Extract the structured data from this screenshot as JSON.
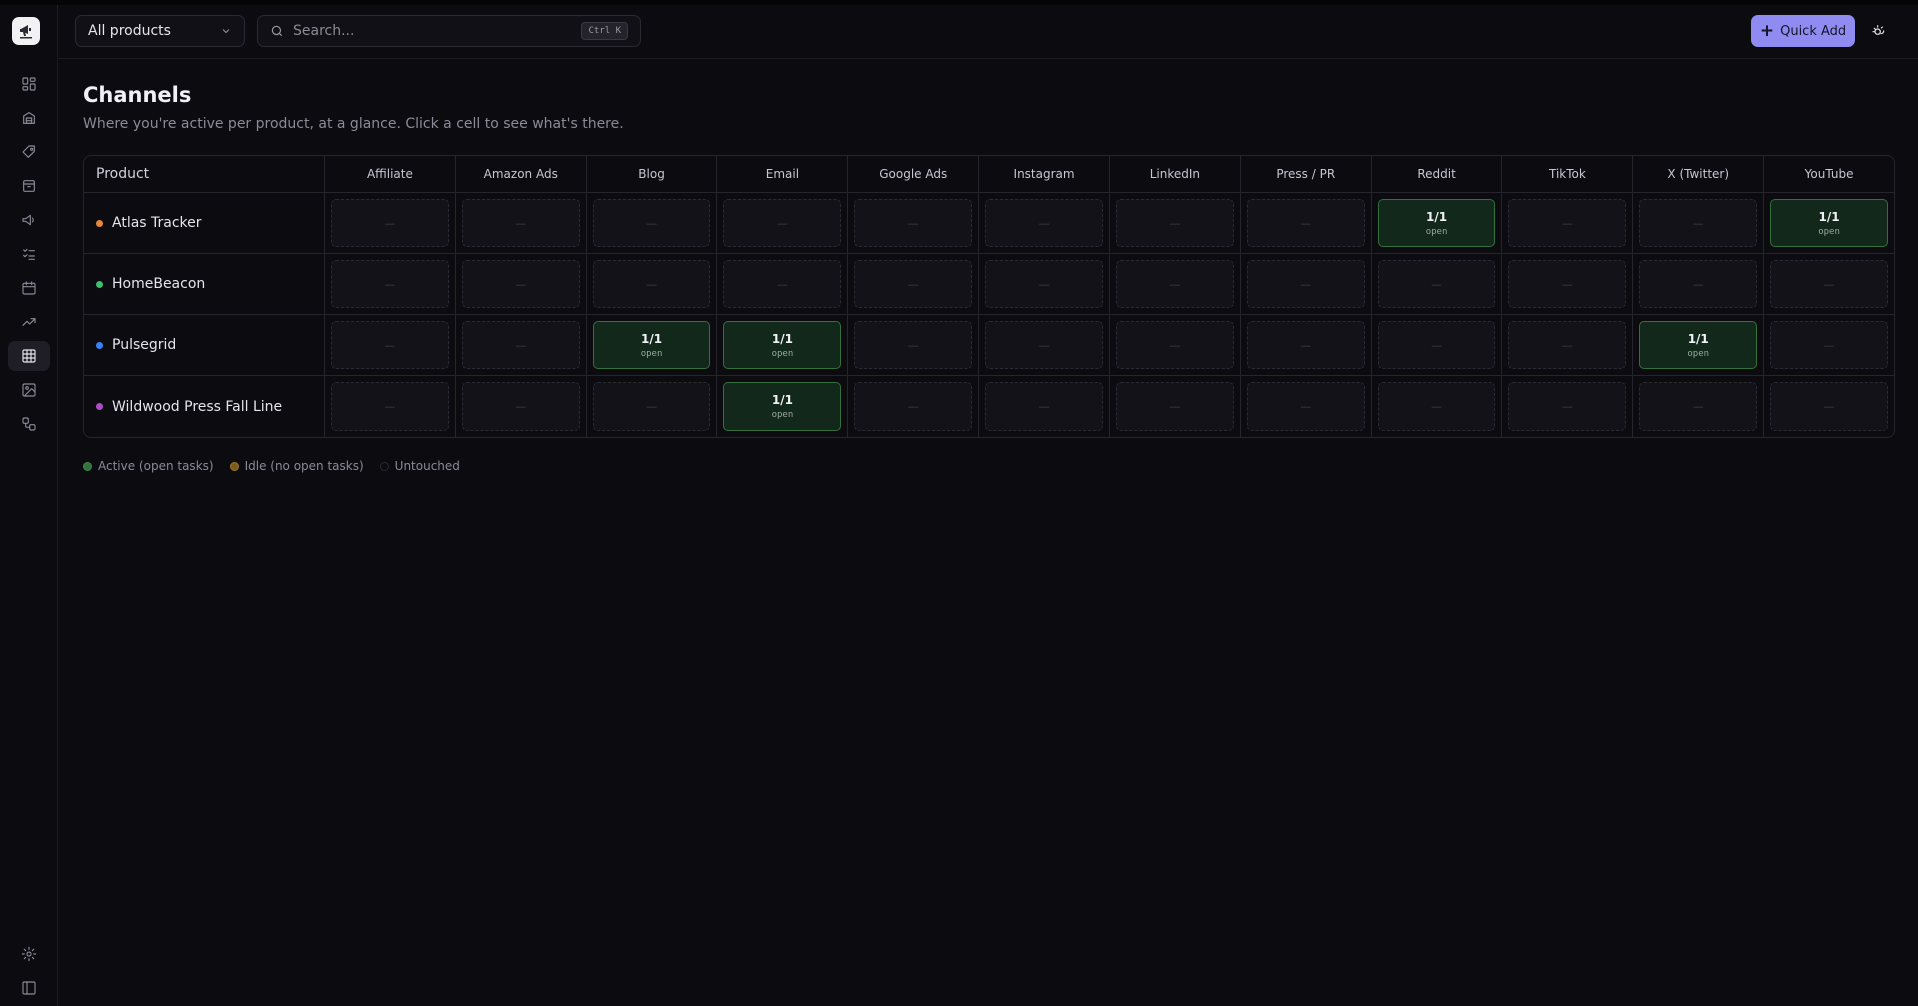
{
  "header": {
    "product_select": "All products",
    "search_placeholder": "Search...",
    "search_shortcut": "Ctrl K",
    "quick_add": "Quick Add"
  },
  "sidebar": {
    "icons": [
      "dashboard-icon",
      "products-icon",
      "tag-icon",
      "box-icon",
      "megaphone-icon",
      "tasks-icon",
      "calendar-icon",
      "trending-icon",
      "grid-icon",
      "image-icon",
      "workflow-icon",
      "settings-icon",
      "sidebar-toggle-icon"
    ],
    "active": "grid-icon"
  },
  "page": {
    "title": "Channels",
    "subtitle": "Where you're active per product, at a glance. Click a cell to see what's there."
  },
  "grid": {
    "product_header": "Product",
    "channels": [
      "Affiliate",
      "Amazon Ads",
      "Blog",
      "Email",
      "Google Ads",
      "Instagram",
      "LinkedIn",
      "Press / PR",
      "Reddit",
      "TikTok",
      "X (Twitter)",
      "YouTube"
    ],
    "untouched_mark": "—",
    "products": [
      {
        "name": "Atlas Tracker",
        "color": "#e8863a",
        "cells": [
          null,
          null,
          null,
          null,
          null,
          null,
          null,
          null,
          {
            "count": "1/1",
            "label": "open"
          },
          null,
          null,
          {
            "count": "1/1",
            "label": "open"
          }
        ]
      },
      {
        "name": "HomeBeacon",
        "color": "#3fbf6a",
        "cells": [
          null,
          null,
          null,
          null,
          null,
          null,
          null,
          null,
          null,
          null,
          null,
          null
        ]
      },
      {
        "name": "Pulsegrid",
        "color": "#3b82f6",
        "cells": [
          null,
          null,
          {
            "count": "1/1",
            "label": "open"
          },
          {
            "count": "1/1",
            "label": "open"
          },
          null,
          null,
          null,
          null,
          null,
          null,
          {
            "count": "1/1",
            "label": "open"
          },
          null
        ]
      },
      {
        "name": "Wildwood Press Fall Line",
        "color": "#b14cc9",
        "cells": [
          null,
          null,
          null,
          {
            "count": "1/1",
            "label": "open"
          },
          null,
          null,
          null,
          null,
          null,
          null,
          null,
          null
        ]
      }
    ]
  },
  "legend": [
    {
      "label": "Active (open tasks)",
      "color": "#33703e",
      "border": "#3f8a4c"
    },
    {
      "label": "Idle (no open tasks)",
      "color": "#7a5a1e",
      "border": "#a27826"
    },
    {
      "label": "Untouched",
      "color": "#0c0b10",
      "border": "#2c2b34"
    }
  ]
}
